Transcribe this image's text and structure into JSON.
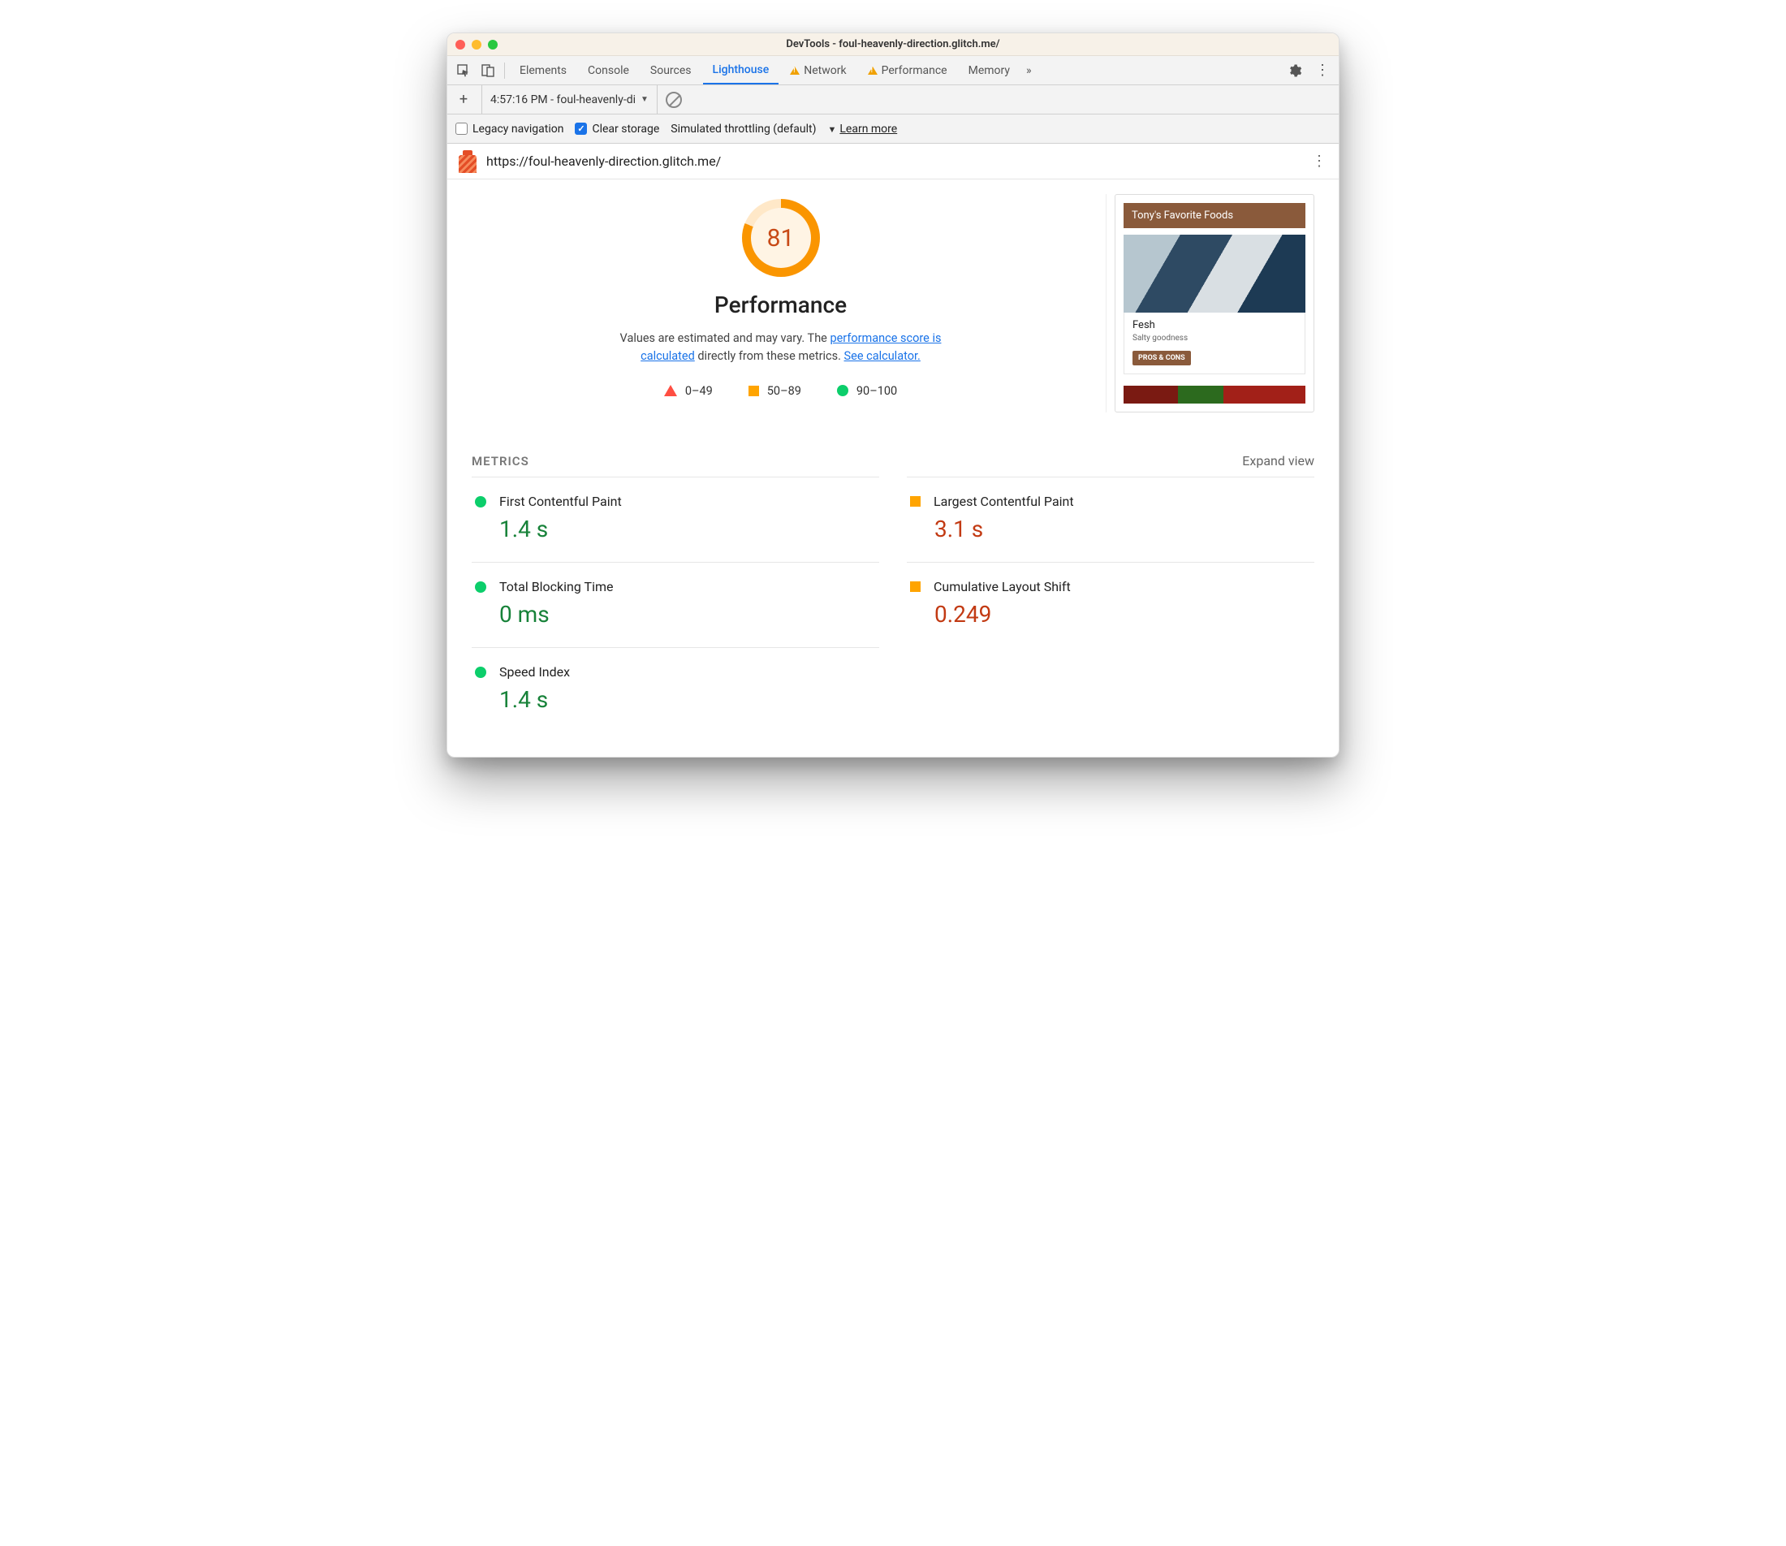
{
  "titlebar": {
    "title": "DevTools - foul-heavenly-direction.glitch.me/"
  },
  "tabs": {
    "items": [
      "Elements",
      "Console",
      "Sources",
      "Lighthouse",
      "Network",
      "Performance",
      "Memory"
    ],
    "active": "Lighthouse",
    "warnings": [
      "Network",
      "Performance"
    ]
  },
  "bar2": {
    "run_label": "4:57:16 PM - foul-heavenly-di"
  },
  "bar3": {
    "legacy_label": "Legacy navigation",
    "clear_label": "Clear storage",
    "throttle_label": "Simulated throttling (default)",
    "learn_label": "Learn more"
  },
  "urlrow": {
    "url": "https://foul-heavenly-direction.glitch.me/"
  },
  "gauge": {
    "score": "81",
    "title": "Performance"
  },
  "subtitle": {
    "pre": "Values are estimated and may vary. The ",
    "link1": "performance score is calculated",
    "mid": " directly from these metrics. ",
    "link2": "See calculator."
  },
  "legend": {
    "r": "0–49",
    "o": "50–89",
    "g": "90–100"
  },
  "preview": {
    "header": "Tony's Favorite Foods",
    "card_title": "Fesh",
    "card_sub": "Salty goodness",
    "btn": "PROS & CONS"
  },
  "metrics": {
    "heading": "METRICS",
    "expand": "Expand view",
    "items": [
      {
        "name": "First Contentful Paint",
        "value": "1.4 s",
        "status": "green"
      },
      {
        "name": "Largest Contentful Paint",
        "value": "3.1 s",
        "status": "orange"
      },
      {
        "name": "Total Blocking Time",
        "value": "0 ms",
        "status": "green"
      },
      {
        "name": "Cumulative Layout Shift",
        "value": "0.249",
        "status": "orange"
      },
      {
        "name": "Speed Index",
        "value": "1.4 s",
        "status": "green"
      }
    ]
  }
}
